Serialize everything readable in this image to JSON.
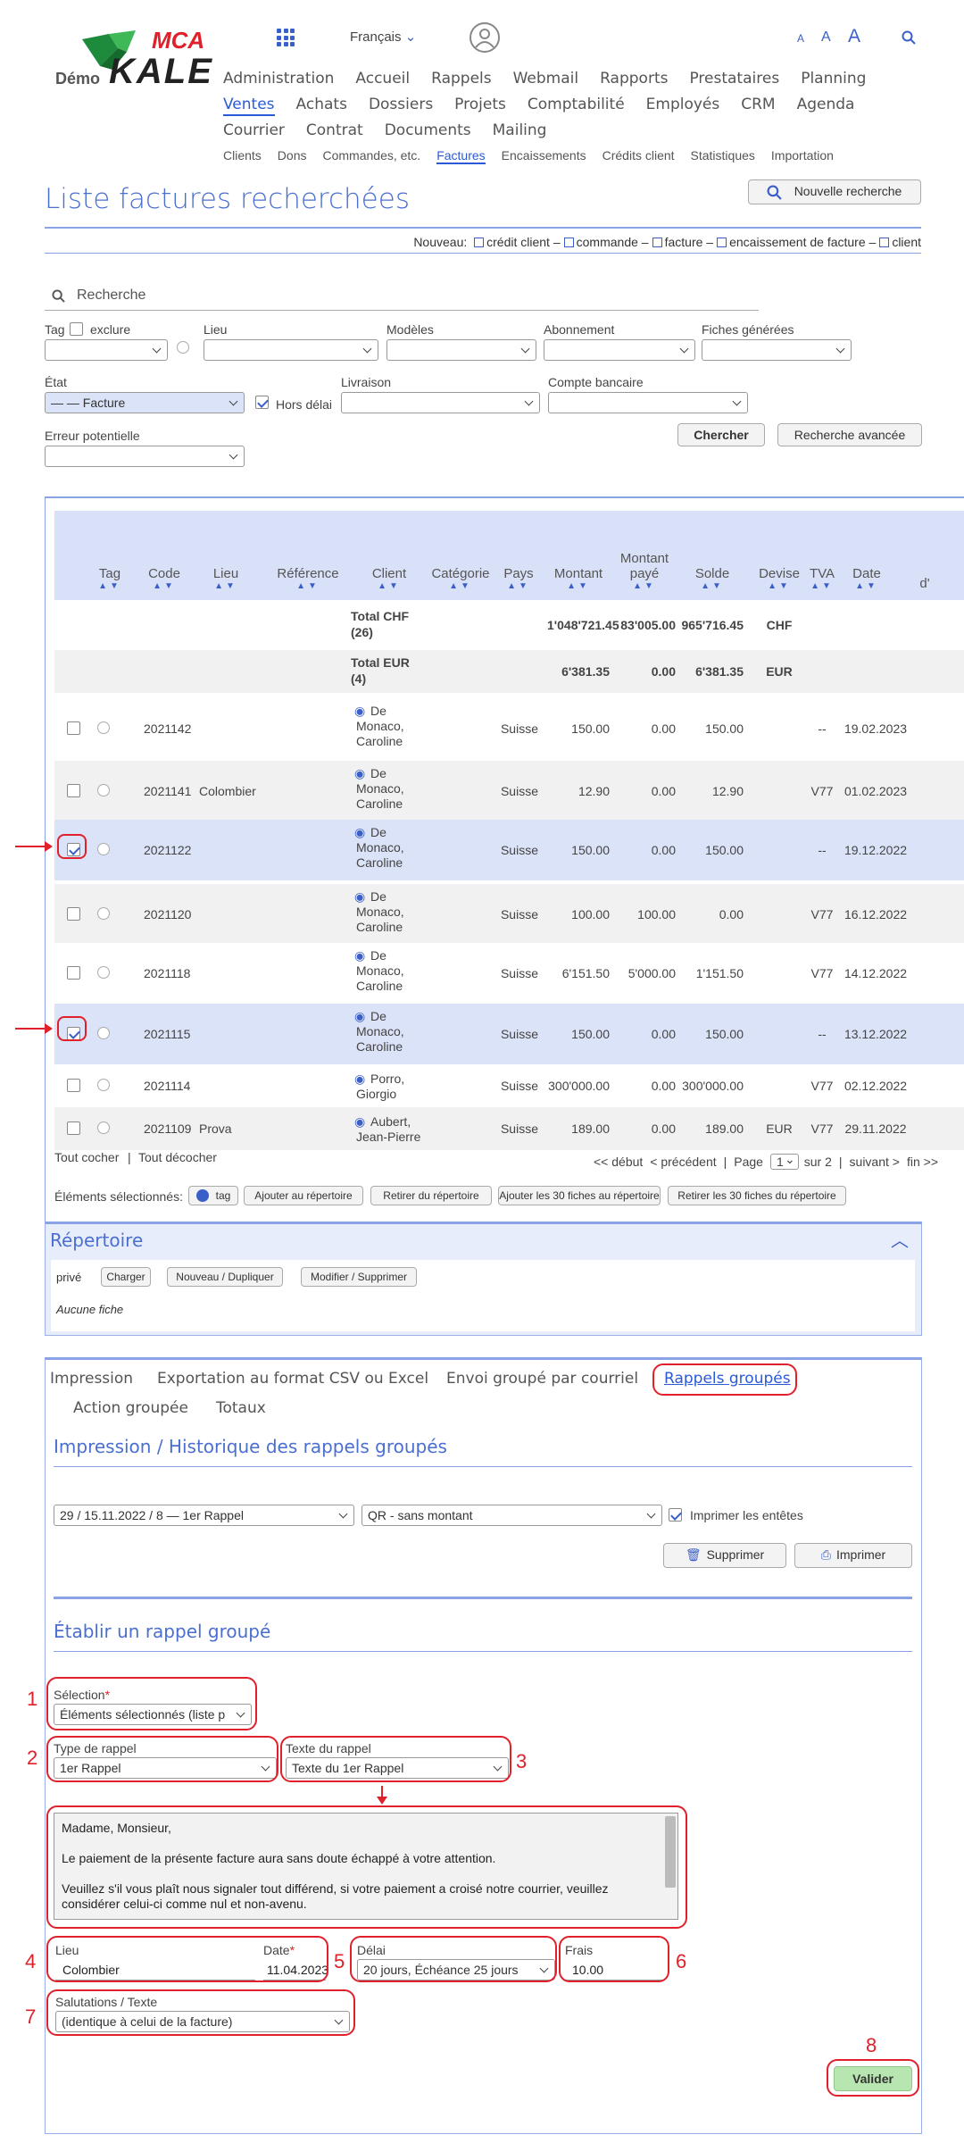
{
  "header": {
    "logo_mca": "MCA",
    "logo_kale": "KALE",
    "logo_demo": "Démo",
    "language": "Français",
    "font_small": "A",
    "font_medium": "A",
    "font_large": "A",
    "nav_main": [
      "Administration",
      "Accueil",
      "Rappels",
      "Webmail",
      "Rapports",
      "Prestataires",
      "Planning",
      "Ventes",
      "Achats",
      "Dossiers",
      "Projets",
      "Comptabilité",
      "Employés",
      "CRM",
      "Agenda",
      "Courrier",
      "Contrat",
      "Documents",
      "Mailing"
    ],
    "nav_active": "Ventes",
    "nav_sub": [
      "Clients",
      "Dons",
      "Commandes, etc.",
      "Factures",
      "Encaissements",
      "Crédits client",
      "Statistiques",
      "Importation"
    ],
    "nav_sub_active": "Factures"
  },
  "page": {
    "title": "Liste factures recherchées",
    "new_search_label": "Nouvelle recherche",
    "new_prefix": "Nouveau:",
    "new_links": [
      "crédit client",
      "commande",
      "facture",
      "encaissement de facture",
      "client"
    ]
  },
  "filters": {
    "search_placeholder": "Recherche",
    "tag_label": "Tag",
    "exclude_label": "exclure",
    "lieu_label": "Lieu",
    "modeles_label": "Modèles",
    "abonnement_label": "Abonnement",
    "fiches_label": "Fiches générées",
    "etat_label": "État",
    "etat_value": "— — Facture",
    "hors_delai_label": "Hors délai",
    "livraison_label": "Livraison",
    "compte_label": "Compte bancaire",
    "erreur_label": "Erreur potentielle",
    "chercher_label": "Chercher",
    "avancee_label": "Recherche avancée"
  },
  "table": {
    "columns": [
      "Tag",
      "Code",
      "Lieu",
      "Référence",
      "Client",
      "Catégorie",
      "Pays",
      "Montant",
      "Montant payé",
      "Solde",
      "Devise",
      "TVA",
      "Date",
      "d'"
    ],
    "totals": [
      {
        "label1": "Total CHF",
        "label2": "(26)",
        "montant": "1'048'721.45",
        "paye": "83'005.00",
        "solde": "965'716.45",
        "devise": "CHF"
      },
      {
        "label1": "Total EUR",
        "label2": "(4)",
        "montant": "6'381.35",
        "paye": "0.00",
        "solde": "6'381.35",
        "devise": "EUR"
      }
    ],
    "rows": [
      {
        "code": "2021142",
        "lieu": "",
        "client": [
          "De",
          "Monaco,",
          "Caroline"
        ],
        "pays": "Suisse",
        "montant": "150.00",
        "paye": "0.00",
        "solde": "150.00",
        "devise": "",
        "tva": "--",
        "date": "19.02.2023",
        "checked": false
      },
      {
        "code": "2021141",
        "lieu": "Colombier",
        "client": [
          "De",
          "Monaco,",
          "Caroline"
        ],
        "pays": "Suisse",
        "montant": "12.90",
        "paye": "0.00",
        "solde": "12.90",
        "devise": "",
        "tva": "V77",
        "date": "01.02.2023",
        "checked": false
      },
      {
        "code": "2021122",
        "lieu": "",
        "client": [
          "De",
          "Monaco,",
          "Caroline"
        ],
        "pays": "Suisse",
        "montant": "150.00",
        "paye": "0.00",
        "solde": "150.00",
        "devise": "",
        "tva": "--",
        "date": "19.12.2022",
        "checked": true
      },
      {
        "code": "2021120",
        "lieu": "",
        "client": [
          "De",
          "Monaco,",
          "Caroline"
        ],
        "pays": "Suisse",
        "montant": "100.00",
        "paye": "100.00",
        "solde": "0.00",
        "devise": "",
        "tva": "V77",
        "date": "16.12.2022",
        "checked": false
      },
      {
        "code": "2021118",
        "lieu": "",
        "client": [
          "De",
          "Monaco,",
          "Caroline"
        ],
        "pays": "Suisse",
        "montant": "6'151.50",
        "paye": "5'000.00",
        "solde": "1'151.50",
        "devise": "",
        "tva": "V77",
        "date": "14.12.2022",
        "checked": false
      },
      {
        "code": "2021115",
        "lieu": "",
        "client": [
          "De",
          "Monaco,",
          "Caroline"
        ],
        "pays": "Suisse",
        "montant": "150.00",
        "paye": "0.00",
        "solde": "150.00",
        "devise": "",
        "tva": "--",
        "date": "13.12.2022",
        "checked": true
      },
      {
        "code": "2021114",
        "lieu": "",
        "client": [
          "Porro,",
          "Giorgio"
        ],
        "pays": "Suisse",
        "montant": "300'000.00",
        "paye": "0.00",
        "solde": "300'000.00",
        "devise": "",
        "tva": "V77",
        "date": "02.12.2022",
        "checked": false
      },
      {
        "code": "2021109",
        "lieu": "Prova",
        "client": [
          "Aubert,",
          "Jean-Pierre"
        ],
        "pays": "Suisse",
        "montant": "189.00",
        "paye": "0.00",
        "solde": "189.00",
        "devise": "EUR",
        "tva": "V77",
        "date": "29.11.2022",
        "checked": false
      }
    ],
    "tout_cocher": "Tout cocher",
    "tout_decocher": "Tout décocher",
    "pager": {
      "debut": "<< début",
      "precedent": "< précédent",
      "page_label": "Page",
      "page": "1",
      "sur": "sur 2",
      "suivant": "suivant >",
      "fin": "fin >>"
    },
    "selected_label": "Éléments sélectionnés:",
    "selected_actions": [
      "tag",
      "Ajouter au répertoire",
      "Retirer du répertoire",
      "Ajouter les 30 fiches au répertoire",
      "Retirer les 30 fiches du répertoire"
    ]
  },
  "repertoire": {
    "title": "Répertoire",
    "prive": "privé",
    "charger": "Charger",
    "nouveau": "Nouveau / Dupliquer",
    "modifier": "Modifier / Supprimer",
    "aucune": "Aucune fiche"
  },
  "tabs": [
    "Impression",
    "Exportation au format CSV ou Excel",
    "Envoi groupé par courriel",
    "Rappels groupés",
    "Action groupée",
    "Totaux"
  ],
  "tab_active": "Rappels groupés",
  "historique": {
    "title": "Impression / Historique des rappels groupés",
    "select1": "29 / 15.11.2022 / 8 — 1er Rappel",
    "select2": "QR - sans montant",
    "print_headers": "Imprimer les entêtes",
    "supprimer": "Supprimer",
    "imprimer": "Imprimer"
  },
  "rappel": {
    "title": "Établir un rappel groupé",
    "selection_label": "Sélection",
    "selection_value": "Éléments sélectionnés (liste p",
    "type_label": "Type de rappel",
    "type_value": "1er Rappel",
    "texte_label": "Texte du rappel",
    "texte_value": "Texte du 1er Rappel",
    "text_lines": [
      "Madame, Monsieur,",
      "",
      "Le paiement de la présente facture aura sans doute échappé à votre attention.",
      "",
      "Veuillez s'il vous plaît nous signaler tout différend, si votre paiement a croisé notre courrier, veuillez",
      "considérer celui-ci comme nul et non-avenu."
    ],
    "lieu_label": "Lieu",
    "lieu_value": "Colombier",
    "date_label": "Date",
    "date_value": "11.04.2023",
    "delai_label": "Délai",
    "delai_value": "20 jours, Échéance 25 jours",
    "frais_label": "Frais",
    "frais_value": "10.00",
    "salutations_label": "Salutations / Texte",
    "salutations_value": "(identique à celui de la facture)",
    "valider": "Valider",
    "required_mark": "*"
  },
  "annotations": [
    "1",
    "2",
    "3",
    "4",
    "5",
    "6",
    "7",
    "8"
  ],
  "colors": {
    "accent": "#4a6fd0",
    "highlight": "#e0202a",
    "selected_row": "#dbe3f8",
    "valider": "#b8e6b0"
  }
}
